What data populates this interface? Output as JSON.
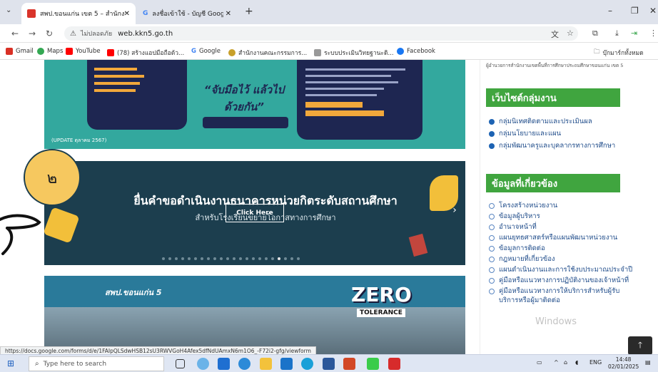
{
  "browser": {
    "tab_active_title": "สพป.ขอนแก่น เขต 5 – สำนักงานเขต...",
    "tab_inactive_title": "ลงชื่อเข้าใช้ - บัญชี Google",
    "new_tab": "+",
    "tab_close": "✕",
    "tab_menu": "⌄",
    "insecure_label": "ไม่ปลอดภัย",
    "url": "web.kkn5.go.th",
    "min": "–",
    "max": "❐",
    "close": "✕"
  },
  "bookmarks": [
    {
      "label": "Gmail",
      "color": "#d93025"
    },
    {
      "label": "Maps",
      "color": "#34a853"
    },
    {
      "label": "YouTube",
      "color": "#ff0000"
    },
    {
      "label": "(78) สร้างแอปมือถือด้ว...",
      "color": "#ff0000"
    },
    {
      "label": "Google",
      "color": "#4285f4"
    },
    {
      "label": "สำนักงานคณะกรรมการ...",
      "color": "#c8a02a"
    },
    {
      "label": "ระบบประเมินวิทยฐานะดิ...",
      "color": "#888888"
    },
    {
      "label": "Facebook",
      "color": "#1877f2"
    }
  ],
  "bookmarks_folder": "บุ๊กมาร์กทั้งหมด",
  "banner1": {
    "slogan": "“จับมือไว้ แล้วไปด้วยกัน”",
    "update_note": "(UPDATE ตุลาคม 2567)"
  },
  "banner2": {
    "title": "ยื่นคำขอดำเนินงานธนาคารหน่วยกิตระดับสถานศึกษา",
    "subtitle": "สำหรับโรงเรียนขยายโอกาสทางการศึกษา",
    "button": "Click Here",
    "next_arrow": "›"
  },
  "banner3": {
    "logo": "สพป.ขอนแก่น 5",
    "zero": "ZERO",
    "tolerance": "TOLERANCE"
  },
  "badge": "๒",
  "sidebar": {
    "top_note": "ผู้อำนวยการสำนักงานเขตพื้นที่การศึกษาประถมศึกษาขอนแก่น เขต 5",
    "heading1": "เว็บไซต์กลุ่มงาน",
    "groups": [
      "กลุ่มนิเทศติดตามและประเมินผล",
      "กลุ่มนโยบายและแผน",
      "กลุ่มพัฒนาครูและบุคลากรทางการศึกษา"
    ],
    "heading2": "ข้อมูลที่เกี่ยวข้อง",
    "related": [
      "โครงสร้างหน่วยงาน",
      "ข้อมูลผู้บริหาร",
      "อำนาจหน้าที่",
      "แผนยุทธศาสตร์หรือแผนพัฒนาหน่วยงาน",
      "ข้อมูลการติดต่อ",
      "กฎหมายที่เกี่ยวข้อง",
      "แผนดำเนินงานและการใช้งบประมาณประจำปี",
      "คู่มือหรือแนวทางการปฏิบัติงานของเจ้าหน้าที่",
      "คู่มือหรือแนวทางการให้บริการสำหรับผู้รับบริการหรือผู้มาติดต่อ"
    ]
  },
  "watermark": "Windows",
  "to_top": "🡑",
  "status_url": "https://docs.google.com/forms/d/e/1FAIpQLSdwHSB12sU3RWVGoH4Afex5dfNdUAmxN6m1O6_-F72i2-gfg/viewform",
  "taskbar": {
    "search_placeholder": "Type here to search",
    "lang": "ENG",
    "time": "14:48",
    "date": "02/01/2025"
  }
}
